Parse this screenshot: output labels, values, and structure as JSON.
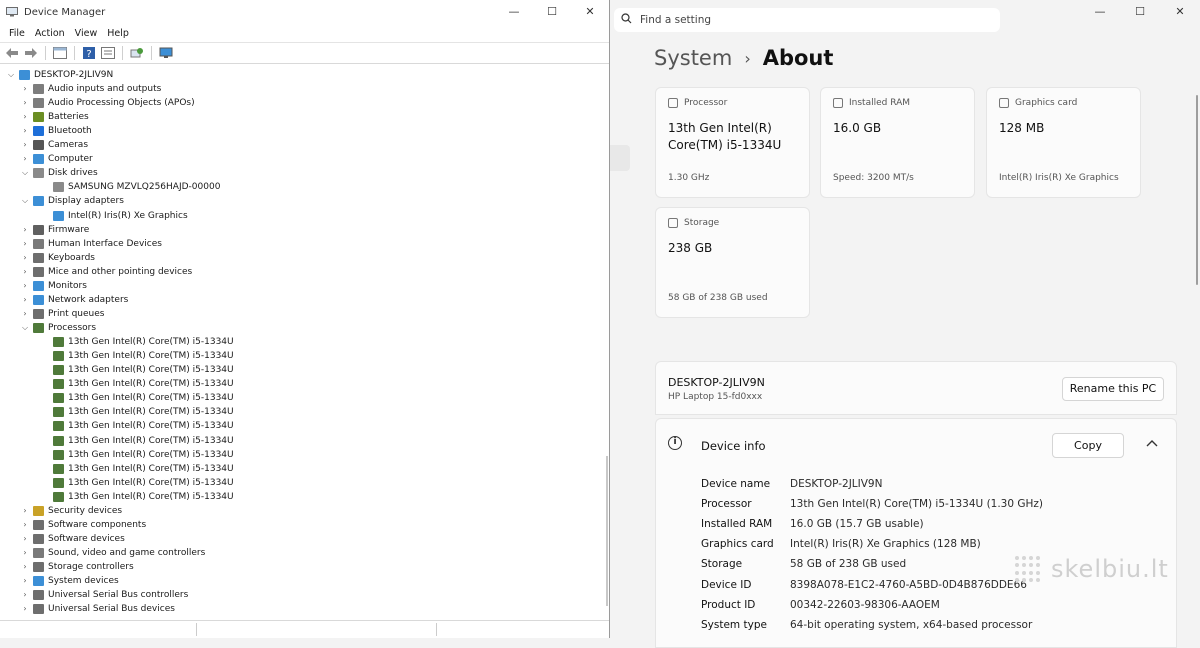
{
  "device_manager": {
    "title": "Device Manager",
    "window_controls": {
      "minimize": "—",
      "maximize": "☐",
      "close": "✕"
    },
    "menu": [
      "File",
      "Action",
      "View",
      "Help"
    ],
    "root": "DESKTOP-2JLIV9N",
    "tree": [
      {
        "label": "Audio inputs and outputs",
        "expanded": false,
        "icon_color": "#7d7d7d"
      },
      {
        "label": "Audio Processing Objects (APOs)",
        "expanded": false,
        "icon_color": "#7d7d7d"
      },
      {
        "label": "Batteries",
        "expanded": false,
        "icon_color": "#6b8e23"
      },
      {
        "label": "Bluetooth",
        "expanded": false,
        "icon_color": "#1e6fd9"
      },
      {
        "label": "Cameras",
        "expanded": false,
        "icon_color": "#555555"
      },
      {
        "label": "Computer",
        "expanded": false,
        "icon_color": "#3c8fd6"
      },
      {
        "label": "Disk drives",
        "expanded": true,
        "icon_color": "#8a8a8a"
      },
      {
        "label": "SAMSUNG MZVLQ256HAJD-00000",
        "child": true,
        "icon_color": "#8a8a8a"
      },
      {
        "label": "Display adapters",
        "expanded": true,
        "icon_color": "#3c8fd6"
      },
      {
        "label": "Intel(R) Iris(R) Xe Graphics",
        "child": true,
        "icon_color": "#3c8fd6"
      },
      {
        "label": "Firmware",
        "expanded": false,
        "icon_color": "#606060"
      },
      {
        "label": "Human Interface Devices",
        "expanded": false,
        "icon_color": "#7a7a7a"
      },
      {
        "label": "Keyboards",
        "expanded": false,
        "icon_color": "#6e6e6e"
      },
      {
        "label": "Mice and other pointing devices",
        "expanded": false,
        "icon_color": "#6e6e6e"
      },
      {
        "label": "Monitors",
        "expanded": false,
        "icon_color": "#3c8fd6"
      },
      {
        "label": "Network adapters",
        "expanded": false,
        "icon_color": "#3c8fd6"
      },
      {
        "label": "Print queues",
        "expanded": false,
        "icon_color": "#6e6e6e"
      },
      {
        "label": "Processors",
        "expanded": true,
        "icon_color": "#4f7a3a"
      },
      {
        "label": "13th Gen Intel(R) Core(TM) i5-1334U",
        "child": true,
        "icon_color": "#4f7a3a"
      },
      {
        "label": "13th Gen Intel(R) Core(TM) i5-1334U",
        "child": true,
        "icon_color": "#4f7a3a"
      },
      {
        "label": "13th Gen Intel(R) Core(TM) i5-1334U",
        "child": true,
        "icon_color": "#4f7a3a"
      },
      {
        "label": "13th Gen Intel(R) Core(TM) i5-1334U",
        "child": true,
        "icon_color": "#4f7a3a"
      },
      {
        "label": "13th Gen Intel(R) Core(TM) i5-1334U",
        "child": true,
        "icon_color": "#4f7a3a"
      },
      {
        "label": "13th Gen Intel(R) Core(TM) i5-1334U",
        "child": true,
        "icon_color": "#4f7a3a"
      },
      {
        "label": "13th Gen Intel(R) Core(TM) i5-1334U",
        "child": true,
        "icon_color": "#4f7a3a"
      },
      {
        "label": "13th Gen Intel(R) Core(TM) i5-1334U",
        "child": true,
        "icon_color": "#4f7a3a"
      },
      {
        "label": "13th Gen Intel(R) Core(TM) i5-1334U",
        "child": true,
        "icon_color": "#4f7a3a"
      },
      {
        "label": "13th Gen Intel(R) Core(TM) i5-1334U",
        "child": true,
        "icon_color": "#4f7a3a"
      },
      {
        "label": "13th Gen Intel(R) Core(TM) i5-1334U",
        "child": true,
        "icon_color": "#4f7a3a"
      },
      {
        "label": "13th Gen Intel(R) Core(TM) i5-1334U",
        "child": true,
        "icon_color": "#4f7a3a"
      },
      {
        "label": "Security devices",
        "expanded": false,
        "icon_color": "#c9a227"
      },
      {
        "label": "Software components",
        "expanded": false,
        "icon_color": "#6e6e6e"
      },
      {
        "label": "Software devices",
        "expanded": false,
        "icon_color": "#6e6e6e"
      },
      {
        "label": "Sound, video and game controllers",
        "expanded": false,
        "icon_color": "#7a7a7a"
      },
      {
        "label": "Storage controllers",
        "expanded": false,
        "icon_color": "#6e6e6e"
      },
      {
        "label": "System devices",
        "expanded": false,
        "icon_color": "#3c8fd6"
      },
      {
        "label": "Universal Serial Bus controllers",
        "expanded": false,
        "icon_color": "#6e6e6e"
      },
      {
        "label": "Universal Serial Bus devices",
        "expanded": false,
        "icon_color": "#6e6e6e"
      }
    ]
  },
  "settings": {
    "search_placeholder": "Find a setting",
    "window_controls": {
      "minimize": "—",
      "maximize": "☐",
      "close": "✕"
    },
    "breadcrumb": {
      "parent": "System",
      "separator": "›",
      "current": "About"
    },
    "cards": [
      {
        "label": "Processor",
        "value_line1": "13th Gen Intel(R)",
        "value_line2": "Core(TM) i5-1334U",
        "sub": "1.30 GHz"
      },
      {
        "label": "Installed RAM",
        "value_line1": "16.0 GB",
        "value_line2": "",
        "sub": "Speed: 3200 MT/s"
      },
      {
        "label": "Graphics card",
        "value_line1": "128 MB",
        "value_line2": "",
        "sub": "Intel(R) Iris(R) Xe Graphics"
      },
      {
        "label": "Storage",
        "value_line1": "238 GB",
        "value_line2": "",
        "sub": "58 GB of 238 GB used"
      }
    ],
    "pc": {
      "name": "DESKTOP-2JLIV9N",
      "model": "HP Laptop 15-fd0xxx",
      "rename_label": "Rename this PC"
    },
    "device_info": {
      "title": "Device info",
      "copy_label": "Copy",
      "rows": [
        {
          "key": "Device name",
          "value": "DESKTOP-2JLIV9N"
        },
        {
          "key": "Processor",
          "value": "13th Gen Intel(R) Core(TM) i5-1334U (1.30 GHz)"
        },
        {
          "key": "Installed RAM",
          "value": "16.0 GB (15.7 GB usable)"
        },
        {
          "key": "Graphics card",
          "value": "Intel(R) Iris(R) Xe Graphics (128 MB)"
        },
        {
          "key": "Storage",
          "value": "58 GB of 238 GB used"
        },
        {
          "key": "Device ID",
          "value": "8398A078-E1C2-4760-A5BD-0D4B876DDE66"
        },
        {
          "key": "Product ID",
          "value": "00342-22603-98306-AAOEM"
        },
        {
          "key": "System type",
          "value": "64-bit operating system, x64-based processor"
        }
      ]
    },
    "watermark": "skelbiu.lt"
  }
}
